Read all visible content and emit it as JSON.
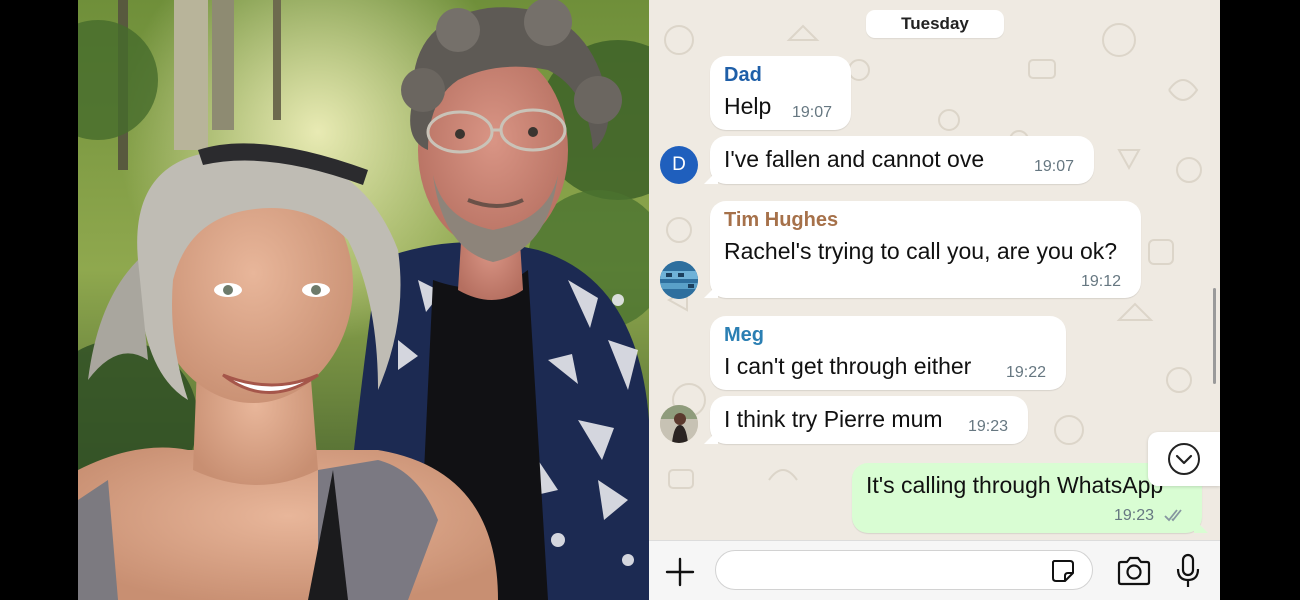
{
  "chat": {
    "day_label": "Tuesday",
    "messages": [
      {
        "sender": "Dad",
        "text": "Help",
        "time": "19:07"
      },
      {
        "avatar_letter": "D",
        "text": "I've fallen and cannot ove",
        "time": "19:07"
      },
      {
        "sender": "Tim Hughes",
        "text": "Rachel's trying to call you, are you ok?",
        "time": "19:12"
      },
      {
        "sender": "Meg",
        "text": "I can't get through either",
        "time": "19:22"
      },
      {
        "text": "I think try Pierre mum",
        "time": "19:23"
      },
      {
        "text": "It's calling through WhatsApp",
        "time": "19:23",
        "status": "read"
      }
    ]
  },
  "composer": {
    "placeholder": ""
  },
  "colors": {
    "sender_dad": "#1f5fa8",
    "sender_tim": "#a6714a",
    "sender_meg": "#2b7fb3",
    "outgoing_bubble": "#d9fdd3",
    "wallpaper": "#efeae2",
    "read_ticks": "#8696a0"
  },
  "icons": [
    "plus-icon",
    "sticker-icon",
    "camera-icon",
    "microphone-icon",
    "chevron-down-icon",
    "double-check-icon"
  ]
}
